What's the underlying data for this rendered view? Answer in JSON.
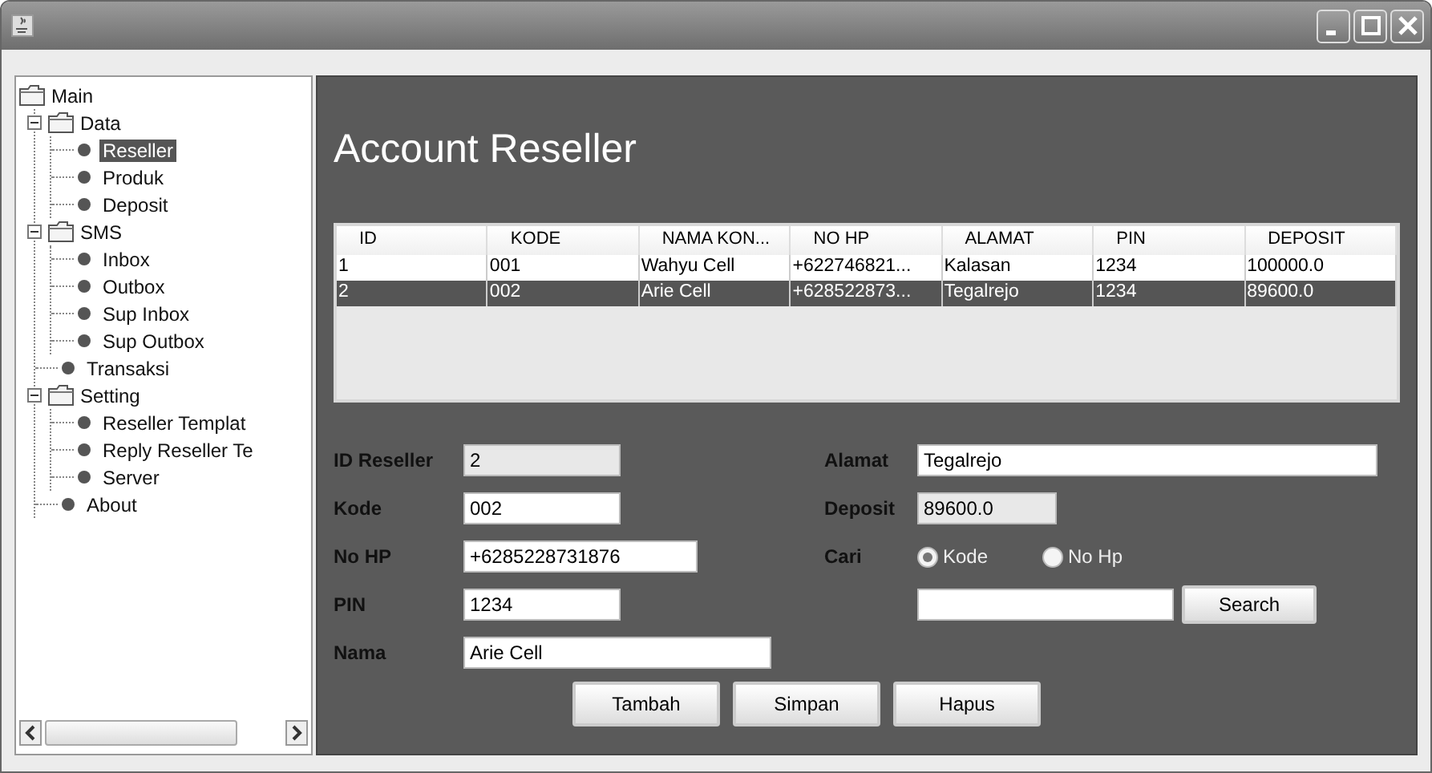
{
  "tree": [
    {
      "label": "Main",
      "kind": "folder",
      "selected": false,
      "children": [
        {
          "label": "Data",
          "kind": "folder",
          "expanded": true,
          "selected": false,
          "children": [
            {
              "label": "Reseller",
              "kind": "leaf",
              "selected": true
            },
            {
              "label": "Produk",
              "kind": "leaf",
              "selected": false
            },
            {
              "label": "Deposit",
              "kind": "leaf",
              "selected": false
            }
          ]
        },
        {
          "label": "SMS",
          "kind": "folder",
          "expanded": true,
          "selected": false,
          "children": [
            {
              "label": "Inbox",
              "kind": "leaf",
              "selected": false
            },
            {
              "label": "Outbox",
              "kind": "leaf",
              "selected": false
            },
            {
              "label": "Sup Inbox",
              "kind": "leaf",
              "selected": false
            },
            {
              "label": "Sup Outbox",
              "kind": "leaf",
              "selected": false
            }
          ]
        },
        {
          "label": "Transaksi",
          "kind": "leaf",
          "selected": false
        },
        {
          "label": "Setting",
          "kind": "folder",
          "expanded": true,
          "selected": false,
          "children": [
            {
              "label": "Reseller Templat",
              "kind": "leaf",
              "selected": false
            },
            {
              "label": "Reply Reseller Te",
              "kind": "leaf",
              "selected": false
            },
            {
              "label": "Server",
              "kind": "leaf",
              "selected": false
            }
          ]
        },
        {
          "label": "About",
          "kind": "leaf",
          "selected": false
        }
      ]
    }
  ],
  "heading": "Account Reseller",
  "table": {
    "columns": [
      "ID",
      "KODE",
      "NAMA KON...",
      "NO HP",
      "ALAMAT",
      "PIN",
      "DEPOSIT"
    ],
    "rows": [
      {
        "cells": [
          "1",
          "001",
          "Wahyu Cell",
          "+622746821...",
          "Kalasan",
          "1234",
          "100000.0"
        ],
        "selected": false
      },
      {
        "cells": [
          "2",
          "002",
          "Arie Cell",
          "+628522873...",
          "Tegalrejo",
          "1234",
          "89600.0"
        ],
        "selected": true
      }
    ]
  },
  "form_left": [
    {
      "label": "ID Reseller",
      "value": "2",
      "editable": false
    },
    {
      "label": "Kode",
      "value": "002",
      "editable": true
    },
    {
      "label": "No HP",
      "value": "+6285228731876",
      "editable": true
    },
    {
      "label": "PIN",
      "value": "1234",
      "editable": true
    },
    {
      "label": "Nama",
      "value": "Arie Cell",
      "editable": true
    }
  ],
  "alamat": {
    "label": "Alamat",
    "value": "Tegalrejo",
    "editable": true
  },
  "deposit": {
    "label": "Deposit",
    "value": "89600.0",
    "editable": false
  },
  "cari": {
    "label": "Cari",
    "options": [
      {
        "label": "Kode",
        "selected": true
      },
      {
        "label": "No Hp",
        "selected": false
      }
    ]
  },
  "search_button": "Search",
  "buttons": [
    "Tambah",
    "Simpan",
    "Hapus"
  ]
}
